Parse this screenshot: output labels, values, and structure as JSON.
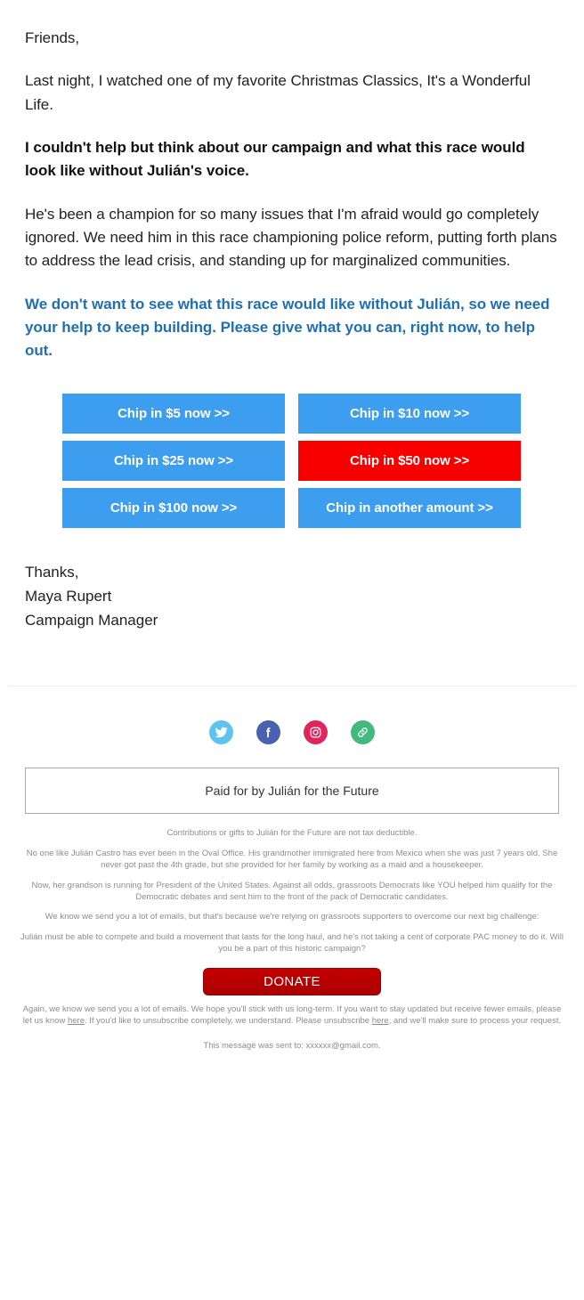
{
  "email": {
    "paragraphs": [
      {
        "id": "greeting",
        "text": "Friends,",
        "style": "plain"
      },
      {
        "id": "intro",
        "text": "Last night, I watched one of my favorite Christmas Classics, It's a Wonderful Life.",
        "style": "plain"
      },
      {
        "id": "hook",
        "text": "I couldn't help but think about our campaign and what this race would look like without Julián's voice.",
        "style": "bold"
      },
      {
        "id": "issues",
        "text": "He's been a champion for so many issues that I'm afraid would go completely ignored. We need him in this race championing police reform, putting forth plans to address the lead crisis, and standing up for marginalized communities.",
        "style": "plain"
      },
      {
        "id": "ask",
        "text": "We don't want to see what this race would like without Julián, so we need your help to keep building. Please give what you can, right now, to help out.",
        "style": "accent"
      }
    ],
    "donation_buttons": [
      {
        "label": "Chip in $5 now >>",
        "amount": "5",
        "highlighted": false
      },
      {
        "label": "Chip in $10 now >>",
        "amount": "10",
        "highlighted": false
      },
      {
        "label": "Chip in $25 now >>",
        "amount": "25",
        "highlighted": false
      },
      {
        "label": "Chip in $50 now >>",
        "amount": "50",
        "highlighted": true
      },
      {
        "label": "Chip in $100 now >>",
        "amount": "100",
        "highlighted": false
      },
      {
        "label": "Chip in another amount >>",
        "amount": "other",
        "highlighted": false
      }
    ],
    "signature": {
      "closing": "Thanks,",
      "name": "Maya Rupert",
      "title": "Campaign Manager"
    }
  },
  "footer": {
    "social": [
      {
        "name": "twitter-icon",
        "label": "Twitter",
        "color": "#5ec3ef"
      },
      {
        "name": "facebook-icon",
        "label": "Facebook",
        "color": "#4a60b0"
      },
      {
        "name": "instagram-icon",
        "label": "Instagram",
        "color": "#e1255c"
      },
      {
        "name": "link-icon",
        "label": "Website",
        "color": "#43b97f"
      }
    ],
    "paid_for_by": "Paid for by Julián for the Future",
    "disclaimer": "Contributions or gifts to Julián for the Future are not tax deductible.",
    "story_1": "No one like Julián Castro has ever been in the Oval Office. His grandmother immigrated here from Mexico when she was just 7 years old. She never got past the 4th grade, but she provided for her family by working as a maid and a housekeeper.",
    "story_2": "Now, her grandson is running for President of the United States. Against all odds, grassroots Democrats like YOU helped him qualify for the Democratic debates and sent him to the front of the pack of Democratic candidates.",
    "story_3": "We know we send you a lot of emails, but that's because we're relying on grassroots supporters to overcome our next big challenge:",
    "story_4": "Julián must be able to compete and build a movement that lasts for the long haul, and he's not taking a cent of corporate PAC money to do it. Will you be a part of this historic campaign?",
    "donate_label": "DONATE",
    "unsubscribe": {
      "part_1": "Again, we know we send you a lot of emails. We hope you'll stick with us long-term. If you want to stay updated but receive fewer emails, please let us know ",
      "link_1": "here",
      "part_2": ". If you'd like to unsubscribe completely, we understand. Please unsubscribe ",
      "link_2": "here",
      "part_3": ", and we'll make sure to process your request."
    },
    "sent_to": "This message was sent to: xxxxxx@gmail.com."
  }
}
